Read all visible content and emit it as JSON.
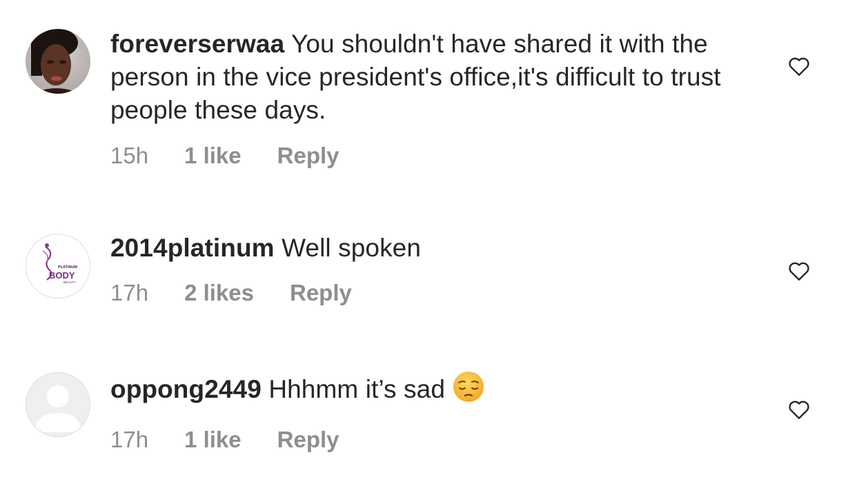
{
  "comments": [
    {
      "username": "foreverserwaa",
      "text": "You shouldn't have shared it with the person in the vice president's office,it's difficult to trust people these days.",
      "time": "15h",
      "likes": "1 like",
      "reply_label": "Reply",
      "avatar": "profile-photo",
      "liked": false
    },
    {
      "username": "2014platinum",
      "text": "Well spoken",
      "time": "17h",
      "likes": "2 likes",
      "reply_label": "Reply",
      "avatar": "platinum-body-beauty-logo",
      "avatar_logo_text": [
        "PLATINUM",
        "BODY",
        "BEAUTY"
      ],
      "liked": false
    },
    {
      "username": "oppong2449",
      "text": "Hhhmm it’s sad",
      "emoji": "pensive-face-emoji",
      "time": "17h",
      "likes": "1 like",
      "reply_label": "Reply",
      "avatar": "default-avatar",
      "liked": false
    }
  ],
  "colors": {
    "text": "#262626",
    "secondary": "#8e8e8e",
    "logo_purple": "#7b2a83",
    "emoji_yellow": "#f7c23b"
  }
}
